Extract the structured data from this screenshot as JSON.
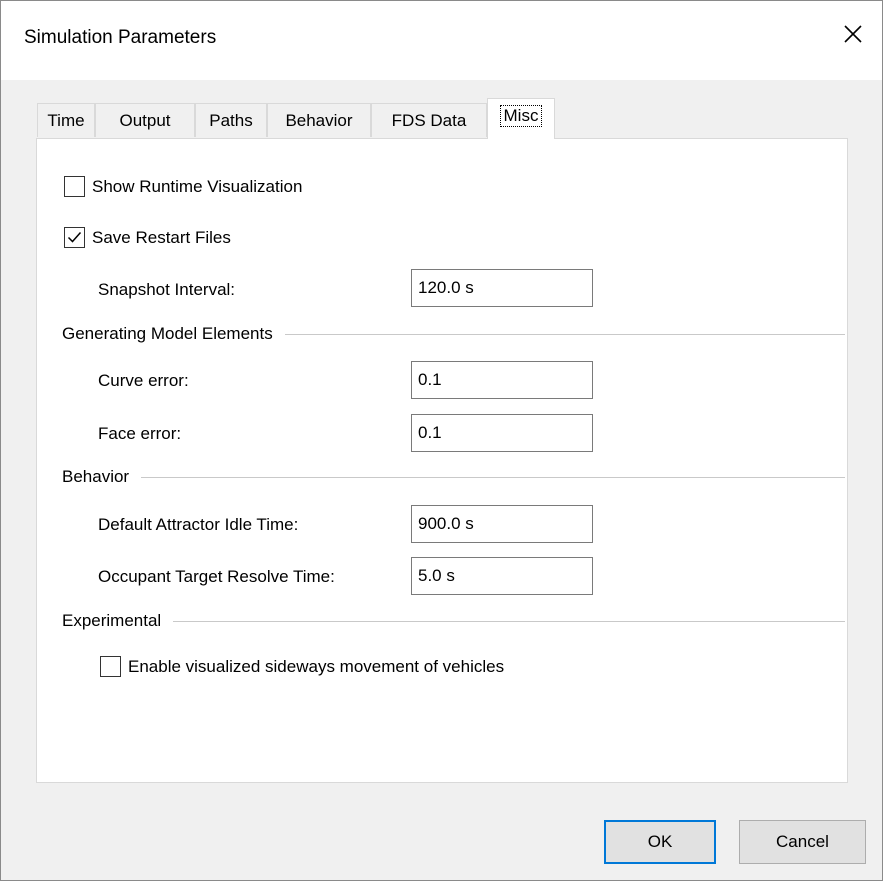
{
  "window": {
    "title": "Simulation Parameters"
  },
  "icons": {
    "close": "close-icon",
    "check": "check-icon"
  },
  "tabs": [
    {
      "label": "Time",
      "active": false
    },
    {
      "label": "Output",
      "active": false
    },
    {
      "label": "Paths",
      "active": false
    },
    {
      "label": "Behavior",
      "active": false
    },
    {
      "label": "FDS Data",
      "active": false
    },
    {
      "label": "Misc",
      "active": true
    }
  ],
  "misc": {
    "show_runtime_visualization": {
      "label": "Show Runtime Visualization",
      "checked": false
    },
    "save_restart_files": {
      "label": "Save Restart Files",
      "checked": true
    },
    "snapshot_interval": {
      "label": "Snapshot Interval:",
      "value": "120.0 s"
    },
    "generating_model_elements": {
      "header": "Generating Model Elements",
      "curve_error": {
        "label": "Curve error:",
        "value": "0.1"
      },
      "face_error": {
        "label": "Face error:",
        "value": "0.1"
      }
    },
    "behavior": {
      "header": "Behavior",
      "default_attractor_idle_time": {
        "label": "Default Attractor Idle Time:",
        "value": "900.0 s"
      },
      "occupant_target_resolve_time": {
        "label": "Occupant Target Resolve Time:",
        "value": "5.0 s"
      }
    },
    "experimental": {
      "header": "Experimental",
      "sideways_movement": {
        "label": "Enable visualized sideways movement of vehicles",
        "checked": false
      }
    }
  },
  "buttons": {
    "ok": "OK",
    "cancel": "Cancel"
  },
  "colors": {
    "accent": "#0078d7"
  }
}
